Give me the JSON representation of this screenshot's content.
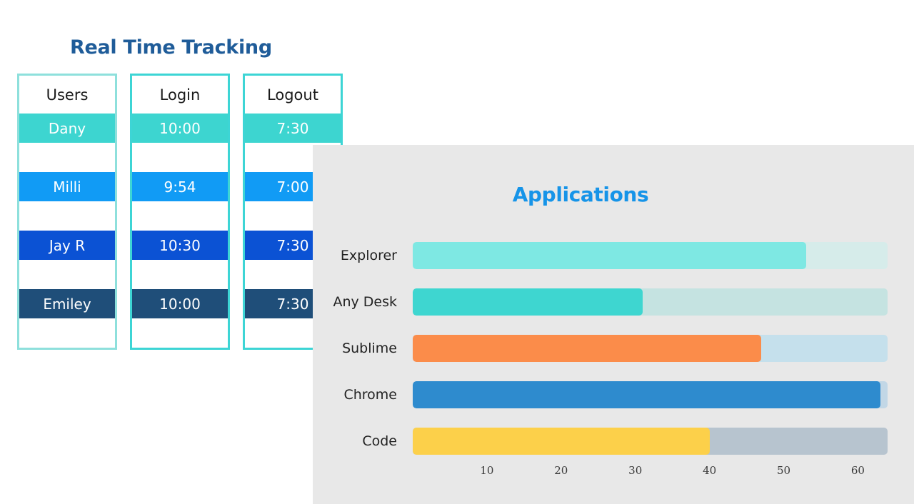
{
  "tracking": {
    "title": "Real Time Tracking",
    "columns": [
      {
        "key": "users",
        "header": "Users",
        "cells": [
          "Dany",
          "",
          "Milli",
          "",
          "Jay R",
          "",
          "Emiley",
          ""
        ]
      },
      {
        "key": "login",
        "header": "Login",
        "cells": [
          "10:00",
          "",
          "9:54",
          "",
          "10:30",
          "",
          "10:00",
          ""
        ]
      },
      {
        "key": "logout",
        "header": "Logout",
        "cells": [
          "7:30",
          "",
          "7:00",
          "",
          "7:30",
          "",
          "7:30",
          ""
        ]
      }
    ],
    "row_colors": [
      "#3dd5d0",
      "#ffffff",
      "#119bf5",
      "#ffffff",
      "#0b52d4",
      "#ffffff",
      "#1f4e79",
      "#ffffff"
    ],
    "border_color_users": "#8ee0dc",
    "border_color_times": "#3dd5d5",
    "title_color": "#1f5c99"
  },
  "applications": {
    "title": "Applications",
    "title_color": "#1694e8",
    "panel_background": "#e8e8e8"
  },
  "chart_data": {
    "type": "bar",
    "orientation": "horizontal",
    "title": "Applications",
    "xlabel": "",
    "ylabel": "",
    "categories": [
      "Explorer",
      "Any Desk",
      "Sublime",
      "Chrome",
      "Code"
    ],
    "values": [
      53,
      31,
      47,
      63,
      40
    ],
    "bar_colors": [
      "#7ee8e3",
      "#3ed6d0",
      "#fb8c4a",
      "#2e8bce",
      "#fcd04a"
    ],
    "track_colors": [
      "#d6ecea",
      "#c5e3e1",
      "#c5e0ec",
      "#c2d7e6",
      "#b7c4cf"
    ],
    "xticks": [
      10,
      20,
      30,
      40,
      50,
      60
    ],
    "xlim": [
      0,
      64
    ],
    "grid": false,
    "legend": "none"
  }
}
